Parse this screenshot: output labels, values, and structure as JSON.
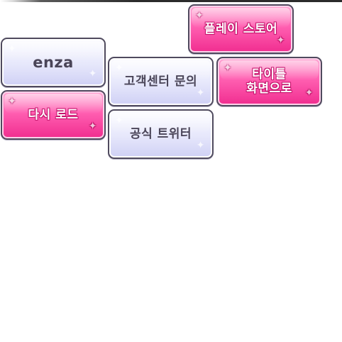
{
  "menu": {
    "enza_label": "enza",
    "reload_label": "다시 로드",
    "support_label": "고객센터 문의",
    "twitter_label": "공식 트위터",
    "store_label": "플레이 스토어",
    "title_line1": "타이틀",
    "title_line2": "화면으로"
  },
  "colors": {
    "lavender_button": "#e6e7fb",
    "pink_button": "#ff5fb1",
    "border": "#4f4a5e",
    "dark_text": "#4a4558"
  }
}
